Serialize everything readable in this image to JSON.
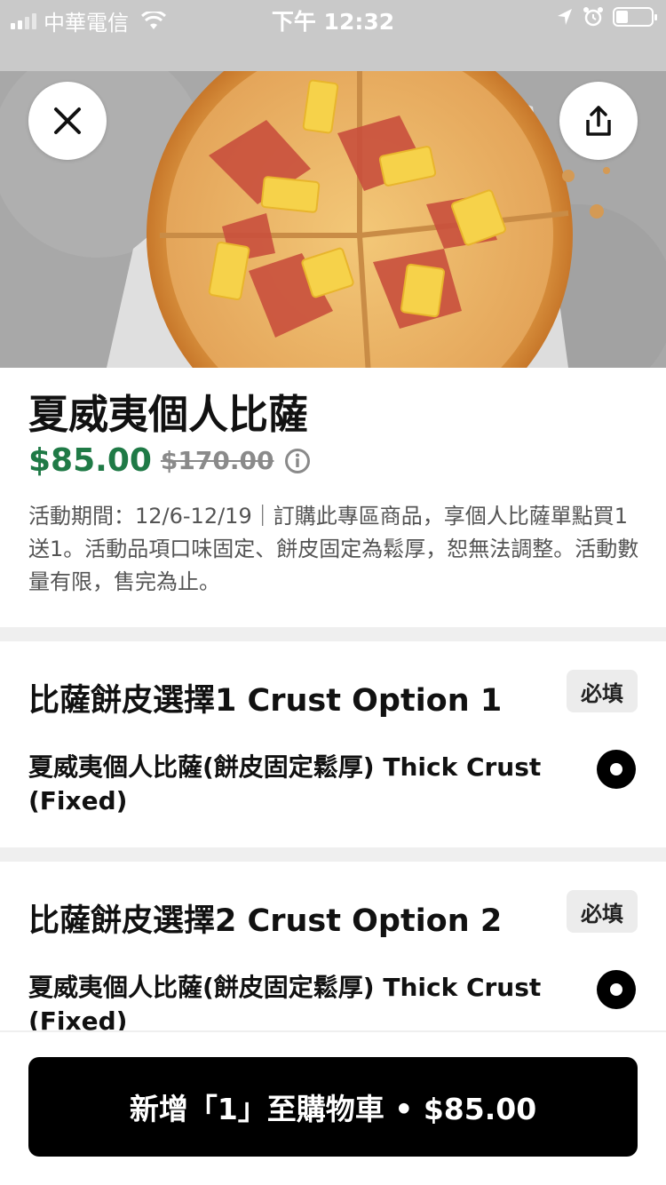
{
  "status_bar": {
    "carrier": "中華電信",
    "time": "下午 12:32",
    "battery_level": 0.35
  },
  "header": {
    "close_icon": "close-icon",
    "share_icon": "share-icon"
  },
  "product": {
    "title": "夏威夷個人比薩",
    "price": "$85.00",
    "original_price": "$170.00",
    "info_icon": "info-icon",
    "description": "活動期間：12/6-12/19｜訂購此專區商品，享個人比薩單點買1送1。活動品項口味固定、餅皮固定為鬆厚，恕無法調整。活動數量有限，售完為止。"
  },
  "options": [
    {
      "title": "比薩餅皮選擇1 Crust Option 1",
      "badge": "必填",
      "choice": "夏威夷個人比薩(餅皮固定鬆厚) Thick Crust (Fixed)",
      "selected": true
    },
    {
      "title": "比薩餅皮選擇2 Crust Option 2",
      "badge": "必填",
      "choice": "夏威夷個人比薩(餅皮固定鬆厚) Thick Crust (Fixed)",
      "selected": true
    }
  ],
  "cart": {
    "button_label": "新增「1」至購物車 • $85.00"
  },
  "colors": {
    "price_green": "#1f7a46",
    "primary_black": "#000000",
    "badge_gray": "#ececec"
  }
}
